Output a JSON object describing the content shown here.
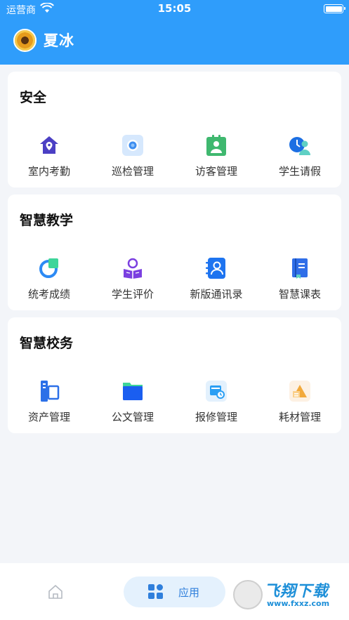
{
  "status_bar": {
    "carrier": "运营商",
    "time": "15:05"
  },
  "header": {
    "username": "夏冰"
  },
  "sections": [
    {
      "title": "安全",
      "apps": [
        {
          "label": "室内考勤",
          "icon": "house-location-icon",
          "color": "#4b3fc4"
        },
        {
          "label": "巡检管理",
          "icon": "camera-inspection-icon",
          "color": "#3e8ef0"
        },
        {
          "label": "访客管理",
          "icon": "visitor-badge-icon",
          "color": "#3fb86f"
        },
        {
          "label": "学生请假",
          "icon": "student-leave-icon",
          "color": "#1c6fe3"
        }
      ]
    },
    {
      "title": "智慧教学",
      "apps": [
        {
          "label": "统考成绩",
          "icon": "pie-chart-icon",
          "color": "#2c8af4"
        },
        {
          "label": "学生评价",
          "icon": "student-reading-icon",
          "color": "#7b3fe0"
        },
        {
          "label": "新版通讯录",
          "icon": "address-book-icon",
          "color": "#1e74f0"
        },
        {
          "label": "智慧课表",
          "icon": "schedule-book-icon",
          "color": "#2f6ee8"
        }
      ]
    },
    {
      "title": "智慧校务",
      "apps": [
        {
          "label": "资产管理",
          "icon": "asset-device-icon",
          "color": "#2c70e8"
        },
        {
          "label": "公文管理",
          "icon": "folder-icon",
          "color": "#1a5ef0"
        },
        {
          "label": "报修管理",
          "icon": "repair-icon",
          "color": "#2a9ff4"
        },
        {
          "label": "耗材管理",
          "icon": "supplies-icon",
          "color": "#f2a93b"
        }
      ]
    }
  ],
  "bottom_bar": {
    "apps_label": "应用"
  },
  "watermark": {
    "line1": "飞翔下载",
    "line2": "www.fxxz.com"
  }
}
